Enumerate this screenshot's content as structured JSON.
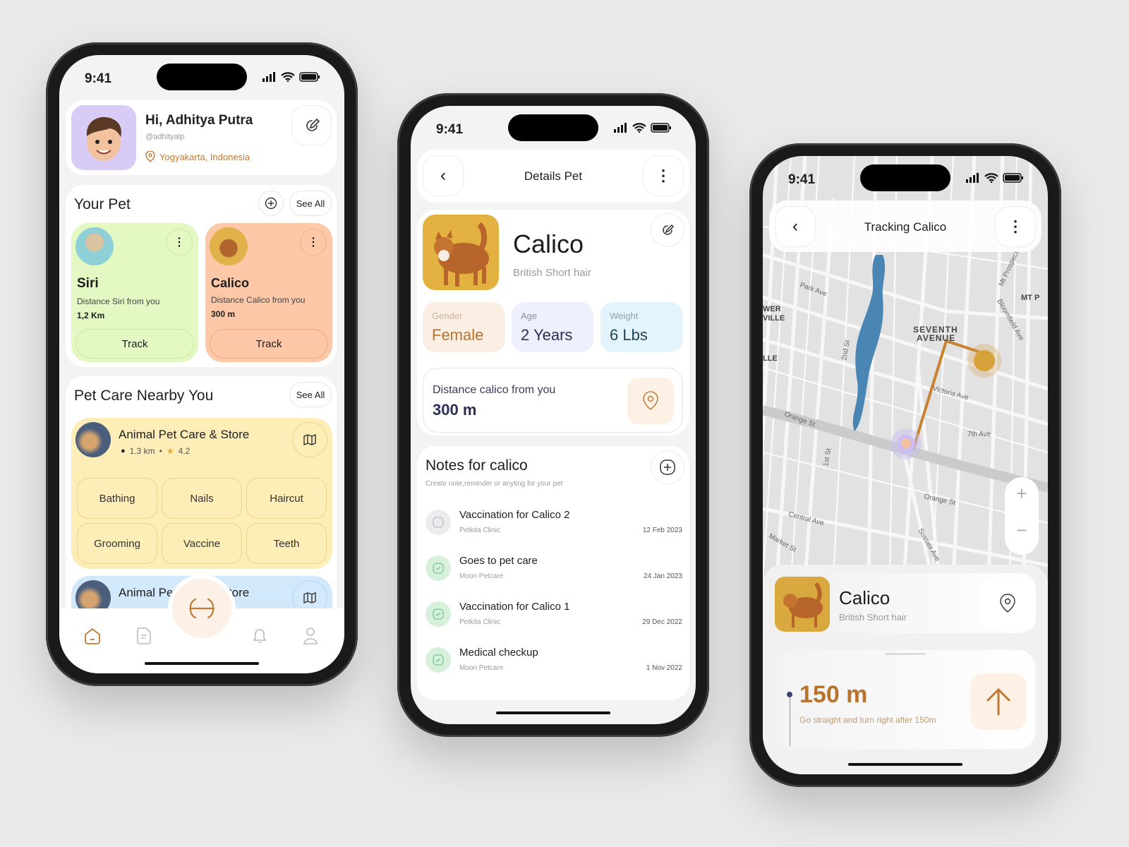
{
  "status": {
    "time": "9:41"
  },
  "home": {
    "greeting": "Hi, Adhitya Putra",
    "handle": "@adhityalp",
    "location": "Yogyakarta, Indonesia",
    "your_pet_title": "Your Pet",
    "see_all": "See All",
    "pets": [
      {
        "name": "Siri",
        "distance_label": "Distance Siri from you",
        "distance": "1,2 Km",
        "track": "Track",
        "color": "#e3f8c2"
      },
      {
        "name": "Calico",
        "distance_label": "Distance Calico from you",
        "distance": "300 m",
        "track": "Track",
        "color": "#fcc8a8"
      }
    ],
    "nearby_title": "Pet Care Nearby You",
    "stores": [
      {
        "name": "Animal Pet Care & Store",
        "distance": "1.3 km",
        "rating": "4.2",
        "color": "#fdedb6",
        "services": [
          "Bathing",
          "Nails",
          "Haircut",
          "Grooming",
          "Vaccine",
          "Teeth"
        ]
      },
      {
        "name": "Animal Pet Care & Store",
        "color": "#d2e8fb"
      }
    ],
    "nav": [
      "home-icon",
      "document-icon",
      "scan-icon",
      "bell-icon",
      "profile-icon"
    ]
  },
  "details": {
    "title": "Details Pet",
    "pet_name": "Calico",
    "breed": "British Short hair",
    "stats": [
      {
        "label": "Gender",
        "value": "Female",
        "color": "#fbeee2"
      },
      {
        "label": "Age",
        "value": "2 Years",
        "color": "#eef0fd"
      },
      {
        "label": "Weight",
        "value": "6 Lbs",
        "color": "#e4f4fd"
      }
    ],
    "distance_label": "Distance calico from you",
    "distance": "300 m",
    "notes_title": "Notes for calico",
    "notes_subtitle": "Create note,reminder or anyting for your pet",
    "notes": [
      {
        "title": "Vaccination for Calico 2",
        "place": "Petkita Clinic",
        "date": "12 Feb 2023",
        "done": false
      },
      {
        "title": "Goes to pet care",
        "place": "Moon Petcare",
        "date": "24 Jan 2023",
        "done": true
      },
      {
        "title": "Vaccination for Calico 1",
        "place": "Petkita Clinic",
        "date": "29 Dec 2022",
        "done": true
      },
      {
        "title": "Medical checkup",
        "place": "Moon Petcare",
        "date": "1 Nov 2022",
        "done": true
      }
    ]
  },
  "tracking": {
    "title": "Tracking Calico",
    "pet_name": "Calico",
    "breed": "British Short hair",
    "distance": "150 m",
    "instruction": "Go straight and turn right after 150m",
    "map_labels": [
      "Park Ave",
      "SEVENTH",
      "AVENUE",
      "Orange St",
      "7th Ave",
      "Orange St",
      "Central Ave",
      "Victoria Ave",
      "1st St",
      "2nd St",
      "Bloomfield Ave",
      "Mt Prospect Ave",
      "Sussex Ave",
      "Market St",
      "WER",
      "VILLE",
      "LLE",
      "MT P"
    ],
    "zoom_in": "+",
    "zoom_out": "−"
  },
  "colors": {
    "accent": "#c07a35",
    "route": "#c9822f",
    "water": "#4a86b3"
  }
}
